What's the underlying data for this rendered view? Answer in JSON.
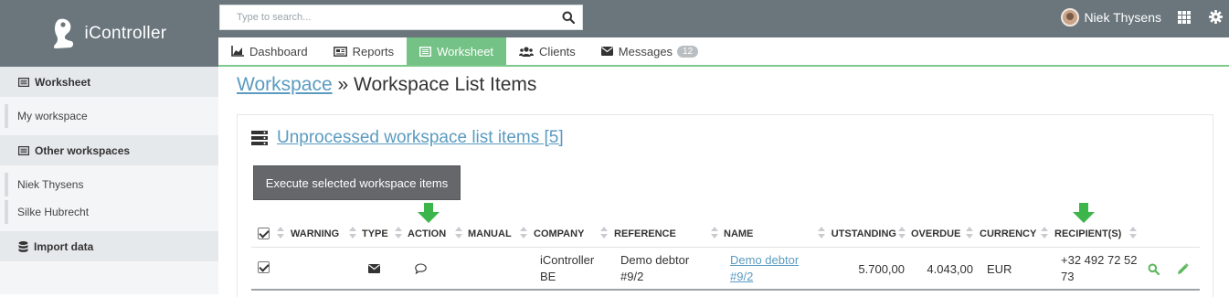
{
  "app": {
    "brand": "iController",
    "search_placeholder": "Type to search...",
    "user_name": "Niek Thysens"
  },
  "tabs": [
    {
      "label": "Dashboard",
      "icon": "area-chart-icon"
    },
    {
      "label": "Reports",
      "icon": "newspaper-icon"
    },
    {
      "label": "Worksheet",
      "icon": "list-alt-icon",
      "active": true
    },
    {
      "label": "Clients",
      "icon": "users-icon"
    },
    {
      "label": "Messages",
      "icon": "envelope-icon",
      "badge": "12"
    }
  ],
  "sidebar": {
    "worksheet_header": "Worksheet",
    "my_workspace": "My workspace",
    "other_header": "Other workspaces",
    "other_items": [
      "Niek Thysens",
      "Silke Hubrecht"
    ],
    "import_header": "Import data"
  },
  "breadcrumb": {
    "link": "Workspace",
    "separator": "»",
    "current": "Workspace List Items"
  },
  "panel": {
    "title": "Unprocessed workspace list items [5]",
    "execute_button": "Execute selected workspace items"
  },
  "table": {
    "headers": {
      "warning": "WARNING",
      "type": "TYPE",
      "action": "ACTION",
      "manual": "MANUAL",
      "company": "COMPANY",
      "reference": "REFERENCE",
      "name": "NAME",
      "outstanding": "OUTSTANDING",
      "overdue": "OVERDUE",
      "currency": "CURRENCY",
      "recipients": "RECIPIENT(S)"
    },
    "rows": [
      {
        "checked": true,
        "type_icon": "envelope-icon",
        "action_icon": "comment-icon",
        "company": "iController BE",
        "reference": "Demo debtor #9/2",
        "name": "Demo debtor #9/2",
        "outstanding": "5.700,00",
        "overdue": "4.043,00",
        "currency": "EUR",
        "recipients": "+32 492 72 52 73"
      }
    ]
  },
  "colors": {
    "topbar": "#6a767c",
    "accent_green": "#74c285",
    "link_blue": "#5b9bc0",
    "arrow_green": "#3cb54a"
  }
}
